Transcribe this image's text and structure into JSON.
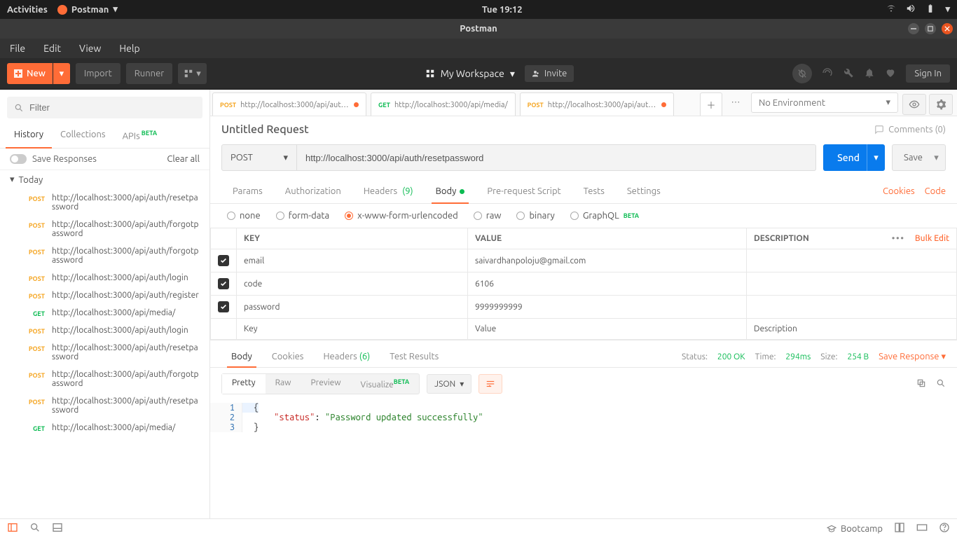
{
  "gnome": {
    "activities": "Activities",
    "app_name": "Postman",
    "clock": "Tue 19:12"
  },
  "window_title": "Postman",
  "app_menu": {
    "file": "File",
    "edit": "Edit",
    "view": "View",
    "help": "Help"
  },
  "toolbar": {
    "new_label": "New",
    "import_label": "Import",
    "runner_label": "Runner",
    "workspace": "My Workspace",
    "invite": "Invite",
    "signin": "Sign In"
  },
  "sidebar": {
    "filter_placeholder": "Filter",
    "tabs": {
      "history": "History",
      "collections": "Collections",
      "apis": "APIs",
      "apis_badge": "BETA"
    },
    "save_responses": "Save Responses",
    "clear_all": "Clear all",
    "group_today": "Today",
    "history": [
      {
        "method": "POST",
        "url": "http://localhost:3000/api/auth/resetpassword"
      },
      {
        "method": "POST",
        "url": "http://localhost:3000/api/auth/forgotpassword"
      },
      {
        "method": "POST",
        "url": "http://localhost:3000/api/auth/forgotpassword"
      },
      {
        "method": "POST",
        "url": "http://localhost:3000/api/auth/login"
      },
      {
        "method": "POST",
        "url": "http://localhost:3000/api/auth/register"
      },
      {
        "method": "GET",
        "url": "http://localhost:3000/api/media/"
      },
      {
        "method": "POST",
        "url": "http://localhost:3000/api/auth/login"
      },
      {
        "method": "POST",
        "url": "http://localhost:3000/api/auth/resetpassword"
      },
      {
        "method": "POST",
        "url": "http://localhost:3000/api/auth/forgotpassword"
      },
      {
        "method": "POST",
        "url": "http://localhost:3000/api/auth/resetpassword"
      },
      {
        "method": "GET",
        "url": "http://localhost:3000/api/media/"
      }
    ]
  },
  "tabs": [
    {
      "method": "POST",
      "label": "http://localhost:3000/api/auth...",
      "dirty": true
    },
    {
      "method": "GET",
      "label": "http://localhost:3000/api/media/",
      "dirty": false
    },
    {
      "method": "POST",
      "label": "http://localhost:3000/api/auth...",
      "dirty": true
    }
  ],
  "env": {
    "selected": "No Environment"
  },
  "request": {
    "title": "Untitled Request",
    "comments": "Comments (0)",
    "method": "POST",
    "url": "http://localhost:3000/api/auth/resetpassword",
    "send": "Send",
    "save": "Save",
    "subtabs": {
      "params": "Params",
      "auth": "Authorization",
      "headers": "Headers",
      "headers_count": "(9)",
      "body": "Body",
      "prereq": "Pre-request Script",
      "tests": "Tests",
      "settings": "Settings",
      "cookies": "Cookies",
      "code": "Code"
    },
    "body_types": {
      "none": "none",
      "formdata": "form-data",
      "urlencoded": "x-www-form-urlencoded",
      "raw": "raw",
      "binary": "binary",
      "graphql": "GraphQL",
      "graphql_badge": "BETA"
    },
    "table": {
      "hdr_key": "KEY",
      "hdr_val": "VALUE",
      "hdr_desc": "DESCRIPTION",
      "bulk": "Bulk Edit",
      "rows": [
        {
          "key": "email",
          "value": "saivardhanpoloju@gmail.com"
        },
        {
          "key": "code",
          "value": "6106"
        },
        {
          "key": "password",
          "value": "9999999999"
        }
      ],
      "ph_key": "Key",
      "ph_val": "Value",
      "ph_desc": "Description"
    }
  },
  "response": {
    "tabs": {
      "body": "Body",
      "cookies": "Cookies",
      "headers": "Headers",
      "headers_count": "(6)",
      "tests": "Test Results"
    },
    "meta": {
      "status_lbl": "Status:",
      "status": "200 OK",
      "time_lbl": "Time:",
      "time": "294ms",
      "size_lbl": "Size:",
      "size": "254 B",
      "save": "Save Response"
    },
    "view": {
      "pretty": "Pretty",
      "raw": "Raw",
      "preview": "Preview",
      "visualize": "Visualize",
      "visualize_badge": "BETA",
      "fmt": "JSON"
    },
    "json": {
      "key": "\"status\"",
      "value": "\"Password updated successfully\""
    }
  },
  "statusbar": {
    "bootcamp": "Bootcamp"
  }
}
